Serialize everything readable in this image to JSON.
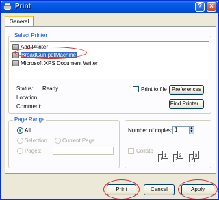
{
  "window": {
    "title": "Print",
    "help_glyph": "?",
    "close_glyph": "×"
  },
  "tabs": [
    {
      "label": "General"
    }
  ],
  "select_printer": {
    "group_label": "Select Printer",
    "printers": [
      {
        "label": "Add Printer",
        "icon": "add-printer-icon"
      },
      {
        "label": "BroadGun pdfMachine",
        "icon": "printer-icon",
        "selected": true
      },
      {
        "label": "Microsoft XPS Document Writer",
        "icon": "printer-icon"
      }
    ],
    "status_label": "Status:",
    "status_value": "Ready",
    "location_label": "Location:",
    "comment_label": "Comment:",
    "print_to_file_label": "Print to file",
    "preferences_label": "Preferences",
    "find_printer_label": "Find Printer..."
  },
  "page_range": {
    "group_label": "Page Range",
    "all_label": "All",
    "selection_label": "Selection",
    "current_page_label": "Current Page",
    "pages_label": "Pages:",
    "pages_value": ""
  },
  "copies": {
    "number_label": "Number of copies:",
    "number_value": "1",
    "collate_label": "Collate",
    "sheet_labels": [
      "1",
      "1",
      "2",
      "2",
      "3",
      "3"
    ]
  },
  "buttons": {
    "print": "Print",
    "cancel": "Cancel",
    "apply": "Apply"
  },
  "colors": {
    "titlebar": "#0054e3",
    "selection": "#316ac5",
    "annotation": "#d4312a"
  }
}
